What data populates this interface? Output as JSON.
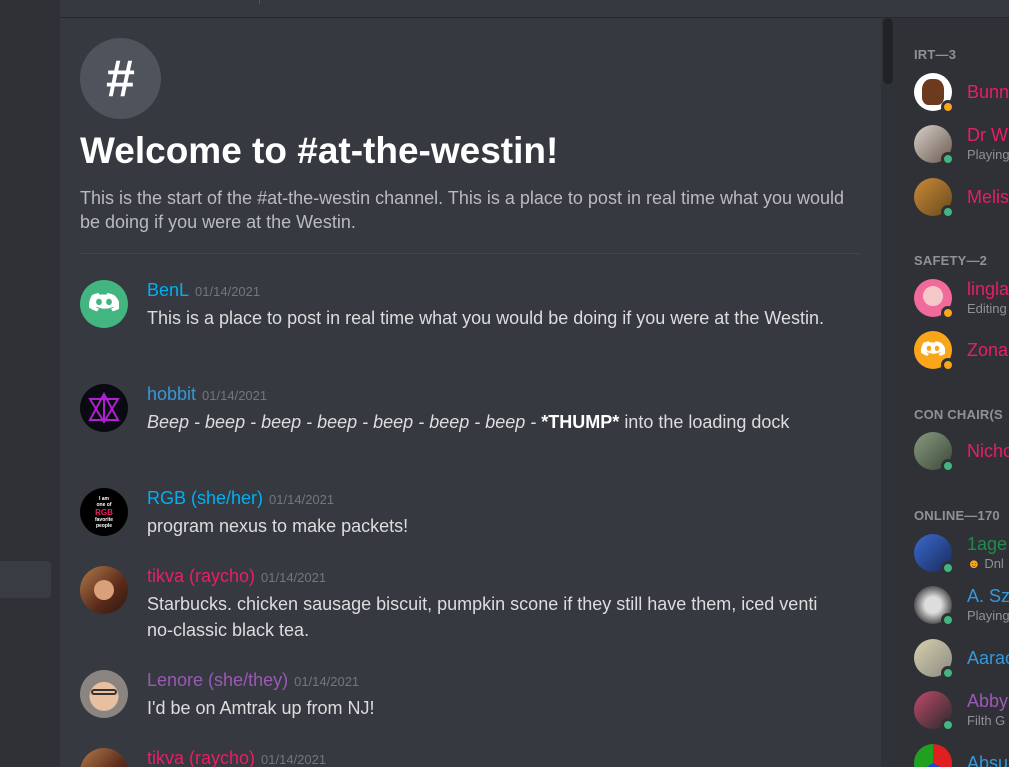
{
  "channel": {
    "hash_icon": "#",
    "welcome_title": "Welcome to #at-the-westin!",
    "welcome_description": "This is the start of the #at-the-westin channel. This is a place to post in real time what you would be doing if you were at the Westin."
  },
  "messages": [
    {
      "author": "BenL",
      "author_color": "#00b0f4",
      "time": "01/14/2021",
      "text": "This is a place to post in real time what you would be doing if you were at the Westin."
    },
    {
      "author": "hobbit",
      "author_color": "#3498db",
      "time": "01/14/2021",
      "text_italic": "Beep - beep - beep - beep - beep - beep - beep - ",
      "text_bold": "*THUMP*",
      "text_rest": " into the loading dock"
    },
    {
      "author": "RGB (she/her)",
      "author_color": "#00b0f4",
      "time": "01/14/2021",
      "text": "program nexus to make packets!",
      "avatar_text": [
        "I am",
        "one of",
        "RGB",
        "favorite",
        "people"
      ]
    },
    {
      "author": "tikva (raycho)",
      "author_color": "#e91e63",
      "time": "01/14/2021",
      "text": "Starbucks. chicken sausage biscuit, pumpkin scone if they still have them, iced venti no-classic black tea."
    },
    {
      "author": "Lenore (she/they)",
      "author_color": "#9b59b6",
      "time": "01/14/2021",
      "text": "I'd be on Amtrak up from NJ!"
    },
    {
      "author": "tikva (raycho)",
      "author_color": "#e91e63",
      "time": "01/14/2021"
    }
  ],
  "member_groups": [
    {
      "label": "IRT—3"
    },
    {
      "label": "SAFETY—2"
    },
    {
      "label": "CON CHAIR(S"
    },
    {
      "label": "ONLINE—170"
    }
  ],
  "members": [
    {
      "name": "Bunn",
      "color": "#e91e63",
      "status": "idle"
    },
    {
      "name": "Dr W",
      "color": "#e91e63",
      "sub": "Playing",
      "status": "online"
    },
    {
      "name": "Melis",
      "color": "#e91e63",
      "status": "online"
    },
    {
      "name": "lingla",
      "color": "#e91e63",
      "sub": "Editing",
      "status": "idle"
    },
    {
      "name": "Zona",
      "color": "#e91e63",
      "status": "idle"
    },
    {
      "name": "Nicho",
      "color": "#e91e63",
      "status": "online"
    },
    {
      "name": "1age",
      "color": "#1f8b4c",
      "sub": "Dnl",
      "status": "online"
    },
    {
      "name": "A. Sz",
      "color": "#3498db",
      "sub": "Playing",
      "status": "online"
    },
    {
      "name": "Aarac",
      "color": "#3498db",
      "status": "online"
    },
    {
      "name": "Abby",
      "color": "#9b59b6",
      "sub": "Filth G",
      "status": "online"
    },
    {
      "name": "Absu",
      "color": "#3498db",
      "status": "online"
    }
  ]
}
